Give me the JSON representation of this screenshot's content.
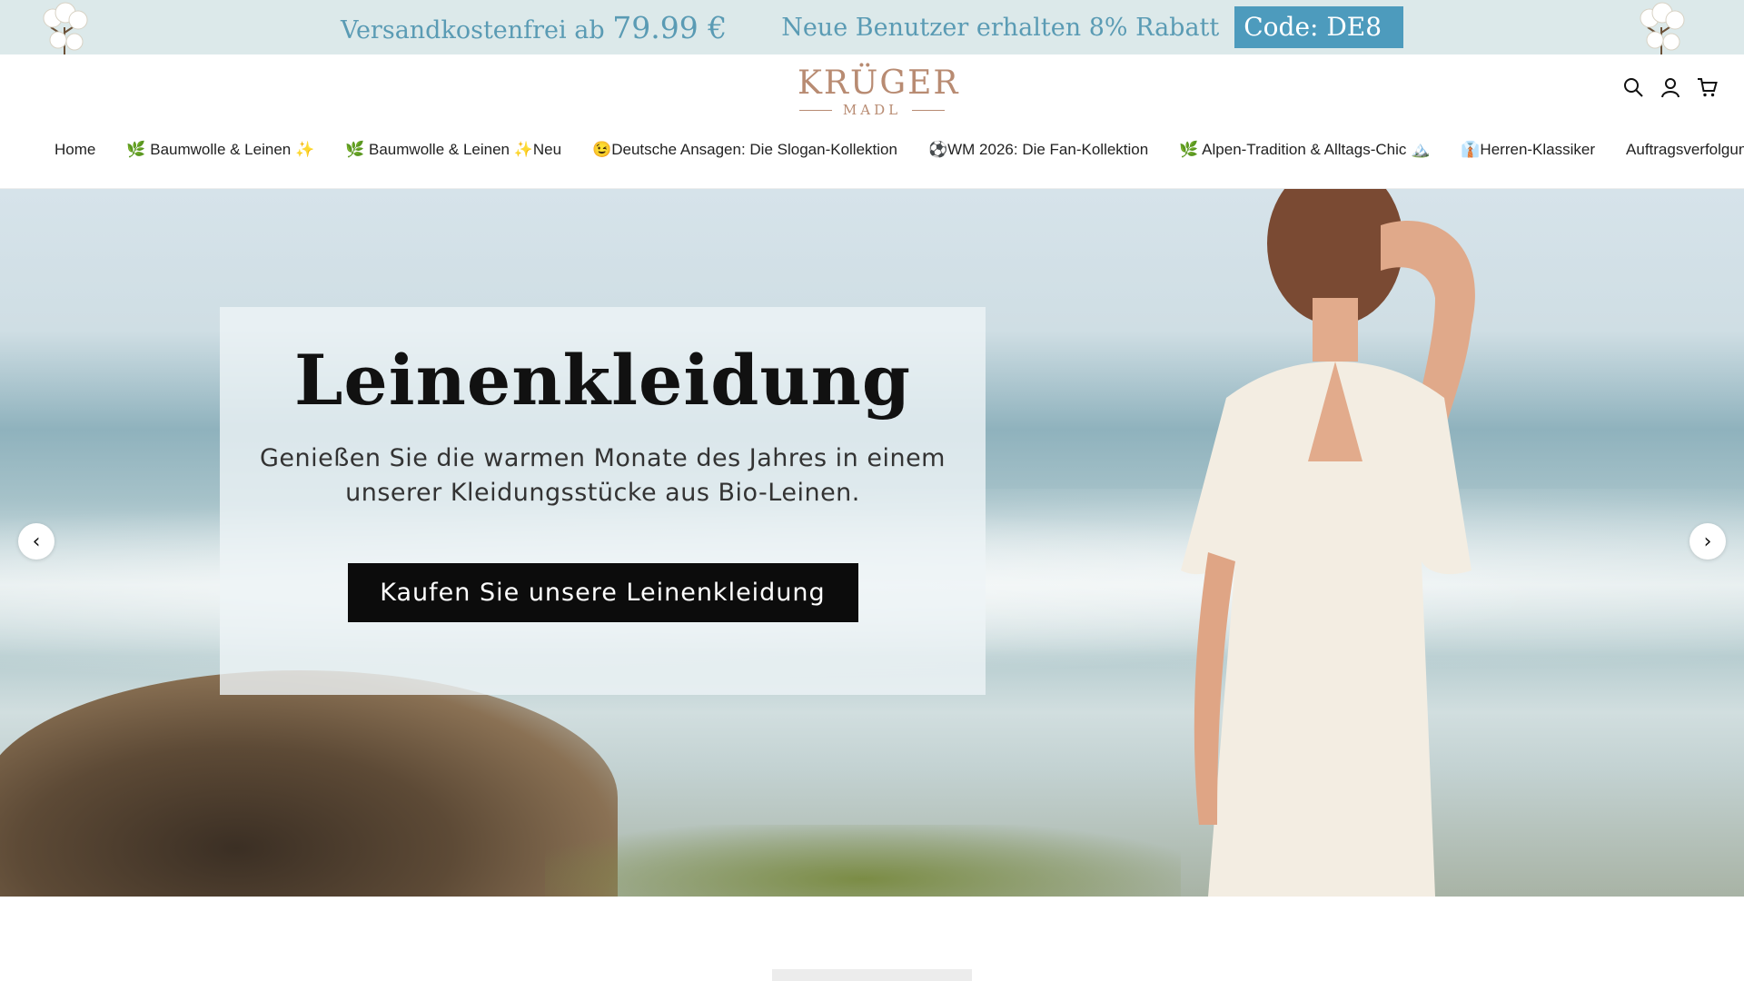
{
  "announcement": {
    "shipping_prefix": "Versandkostenfrei ab",
    "shipping_amount": "79.99 €",
    "new_users": "Neue Benutzer erhalten 8% Rabatt",
    "code": "Code: DE8",
    "colors": {
      "background": "#dce9ea",
      "text": "#5a9bb4",
      "code_bg": "#4d9bbd"
    }
  },
  "header": {
    "logo": {
      "brand": "KRÜGER",
      "sub": "MADL",
      "color": "#b88b72"
    },
    "icons": [
      "search-icon",
      "account-icon",
      "cart-icon"
    ]
  },
  "nav": {
    "items": [
      {
        "label": "Home"
      },
      {
        "label": "🌿 Baumwolle & Leinen ✨"
      },
      {
        "label": "🌿 Baumwolle & Leinen ✨Neu"
      },
      {
        "label": "😉Deutsche Ansagen: Die Slogan-Kollektion"
      },
      {
        "label": "⚽WM 2026: Die Fan-Kollektion"
      },
      {
        "label": "🌿 Alpen-Tradition & Alltags-Chic 🏔️"
      },
      {
        "label": "👔Herren-Klassiker"
      },
      {
        "label": "Auftragsverfolgung"
      }
    ]
  },
  "hero": {
    "title": "Leinenkleidung",
    "description": "Genießen Sie die warmen Monate des Jahres in einem unserer Kleidungsstücke aus Bio-Leinen.",
    "cta": "Kaufen Sie unsere Leinenkleidung",
    "prev_arrow": "‹",
    "next_arrow": "›"
  }
}
